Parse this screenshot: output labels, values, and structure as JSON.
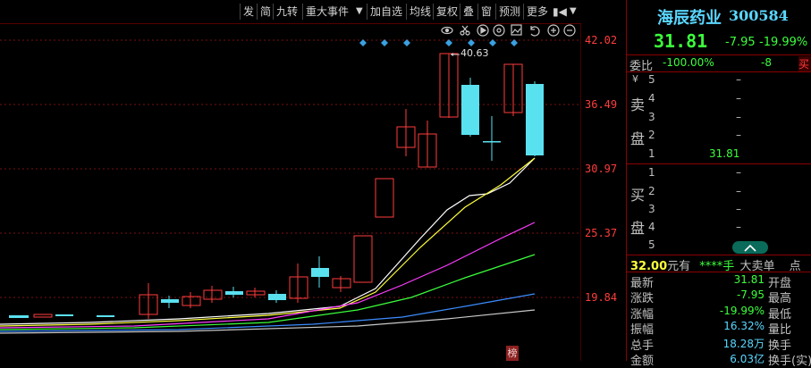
{
  "toolbar": {
    "buttons": [
      "发",
      "简",
      "九转",
      "重大事件",
      "加自选",
      "均线",
      "复权",
      "叠",
      "窗",
      "预测",
      "更多"
    ]
  },
  "chart": {
    "price_ticks": [
      "42.02",
      "36.49",
      "30.97",
      "25.37",
      "19.84"
    ],
    "high_marker": "40.63",
    "bottom_tag": "榜",
    "toolbar_icons": [
      "eye-icon",
      "scissors-icon",
      "play-icon",
      "camera-icon",
      "image-icon",
      "undo-icon",
      "zoom-in-icon",
      "zoom-out-icon"
    ]
  },
  "stock": {
    "name": "海辰药业",
    "code": "300584",
    "price": "31.81",
    "change": "-7.95",
    "change_pct": "-19.99%"
  },
  "order_book": {
    "wei_label": "委比",
    "wei_bi": "-100.00%",
    "wei_cha": "-8",
    "right_tag": "买",
    "sell_label": [
      "卖",
      "盘"
    ],
    "buy_label": [
      "买",
      "盘"
    ],
    "sells": [
      {
        "level": "5",
        "price": "–",
        "vol": ""
      },
      {
        "level": "4",
        "price": "–",
        "vol": ""
      },
      {
        "level": "3",
        "price": "–",
        "vol": ""
      },
      {
        "level": "2",
        "price": "–",
        "vol": ""
      },
      {
        "level": "1",
        "price": "31.81",
        "vol": ""
      }
    ],
    "buys": [
      {
        "level": "1",
        "price": "–",
        "vol": ""
      },
      {
        "level": "2",
        "price": "–",
        "vol": ""
      },
      {
        "level": "3",
        "price": "–",
        "vol": ""
      },
      {
        "level": "4",
        "price": "–",
        "vol": ""
      },
      {
        "level": "5",
        "price": "–",
        "vol": ""
      }
    ],
    "yen": "¥"
  },
  "big_order": {
    "price": "32.00",
    "text": "元有",
    "stars": "****手",
    "label": "大卖单",
    "dot": "点"
  },
  "quote": {
    "rows": [
      {
        "l": "最新",
        "v": "31.81",
        "r": "开盘"
      },
      {
        "l": "涨跌",
        "v": "-7.95",
        "r": "最高"
      },
      {
        "l": "涨幅",
        "v": "-19.99%",
        "r": "最低"
      },
      {
        "l": "振幅",
        "v": "16.32%",
        "r": "量比"
      },
      {
        "l": "总手",
        "v": "18.28万",
        "r": "换手"
      },
      {
        "l": "金额",
        "v": "6.03亿",
        "r": "换手(实)"
      }
    ]
  }
}
